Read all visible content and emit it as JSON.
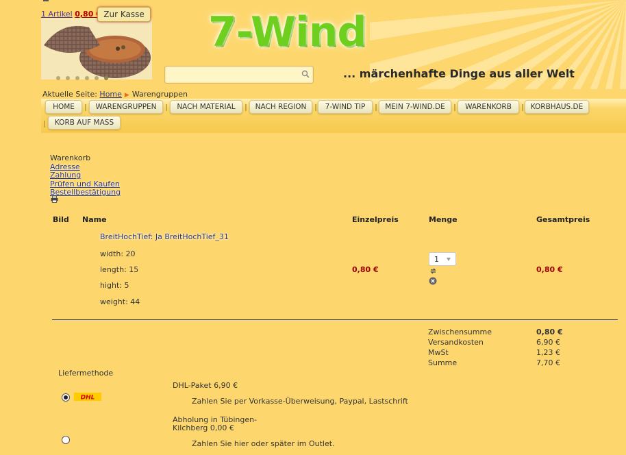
{
  "header": {
    "cart_count": "1 Artikel",
    "cart_price": "0,80 €",
    "checkout_button": "Zur Kasse",
    "logo_text": "7-Wind",
    "tagline": "... märchenhafte Dinge aus aller Welt",
    "search_placeholder": ""
  },
  "breadcrumb": {
    "prefix": "Aktuelle Seite:",
    "home": "Home",
    "current": "Warengruppen"
  },
  "nav": {
    "items": [
      "HOME",
      "WARENGRUPPEN",
      "NACH MATERIAL",
      "NACH REGION",
      "7-WIND TIP",
      "MEIN 7-WIND.DE",
      "WARENKORB",
      "KORBHAUS.DE",
      "KORB AUF MASS"
    ]
  },
  "steps": {
    "current": "Warenkorb",
    "links": [
      "Adresse",
      "Zahlung",
      "Prüfen und Kaufen",
      "Bestellbestätigung"
    ]
  },
  "table": {
    "headers": {
      "image": "Bild",
      "name": "Name",
      "unit_price": "Einzelpreis",
      "quantity": "Menge",
      "total": "Gesamtpreis"
    },
    "row": {
      "product": "BreitHochTief: Ja BreitHochTief_31",
      "attributes": [
        "width: 20",
        "length: 15",
        "hight: 5",
        "weight: 44"
      ],
      "unit_price": "0,80 €",
      "quantity": "1",
      "total": "0,80 €"
    }
  },
  "summary": {
    "labels": [
      "Zwischensumme",
      "Versandkosten",
      "MwSt",
      "Summe"
    ],
    "values": [
      "0,80 €",
      "6,90 €",
      "1,23 €",
      "7,70 €"
    ]
  },
  "shipping": {
    "heading": "Liefermethode",
    "options": [
      {
        "title": "DHL-Paket 6,90 €",
        "note": "Zahlen Sie per Vorkasse-Überweisung, Paypal, Lastschrift",
        "logo": "DHL",
        "checked": true
      },
      {
        "title_line1": "Abholung in Tübingen-",
        "title_line2": "Kilchberg 0,00 €",
        "note": "Zahlen Sie hier oder später im Outlet.",
        "checked": false
      }
    ]
  },
  "colors": {
    "background": "#fdd76e",
    "logo_green": "#6fcf1f",
    "price_red": "#a00000",
    "link_blue": "#2b3a8f"
  }
}
